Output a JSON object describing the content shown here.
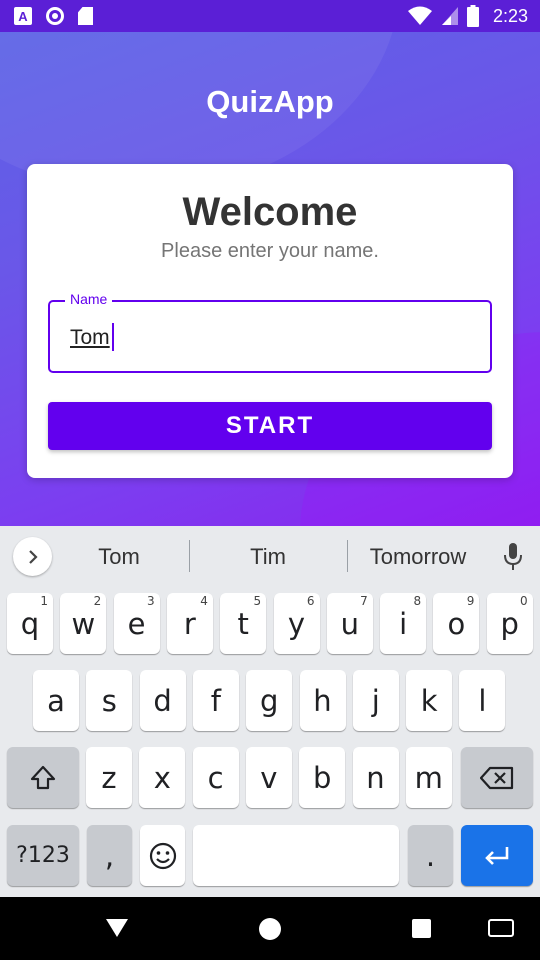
{
  "status_bar": {
    "time": "2:23",
    "left_icons": [
      "a-box-icon",
      "circle-icon",
      "sd-card-icon"
    ],
    "right_icons": [
      "wifi-icon",
      "signal-icon",
      "battery-icon"
    ]
  },
  "app": {
    "title": "QuizApp",
    "welcome": "Welcome",
    "subtitle": "Please enter your name.",
    "name_field": {
      "label": "Name",
      "value": "Tom"
    },
    "start_button": "START",
    "colors": {
      "primary": "#6200ee",
      "gradient_start": "#5c63e6",
      "gradient_end": "#8a24ee"
    }
  },
  "keyboard": {
    "suggestions": [
      "Tom",
      "Tim",
      "Tomorrow"
    ],
    "row1": [
      {
        "k": "q",
        "h": "1"
      },
      {
        "k": "w",
        "h": "2"
      },
      {
        "k": "e",
        "h": "3"
      },
      {
        "k": "r",
        "h": "4"
      },
      {
        "k": "t",
        "h": "5"
      },
      {
        "k": "y",
        "h": "6"
      },
      {
        "k": "u",
        "h": "7"
      },
      {
        "k": "i",
        "h": "8"
      },
      {
        "k": "o",
        "h": "9"
      },
      {
        "k": "p",
        "h": "0"
      }
    ],
    "row2": [
      "a",
      "s",
      "d",
      "f",
      "g",
      "h",
      "j",
      "k",
      "l"
    ],
    "row3": [
      "z",
      "x",
      "c",
      "v",
      "b",
      "n",
      "m"
    ],
    "symbols_key": "?123",
    "comma_key": ",",
    "period_key": ".",
    "enter_color": "#1a73e8"
  },
  "nav_bar": {
    "icons": [
      "back-icon",
      "home-icon",
      "recents-icon",
      "keyboard-switch-icon"
    ]
  }
}
